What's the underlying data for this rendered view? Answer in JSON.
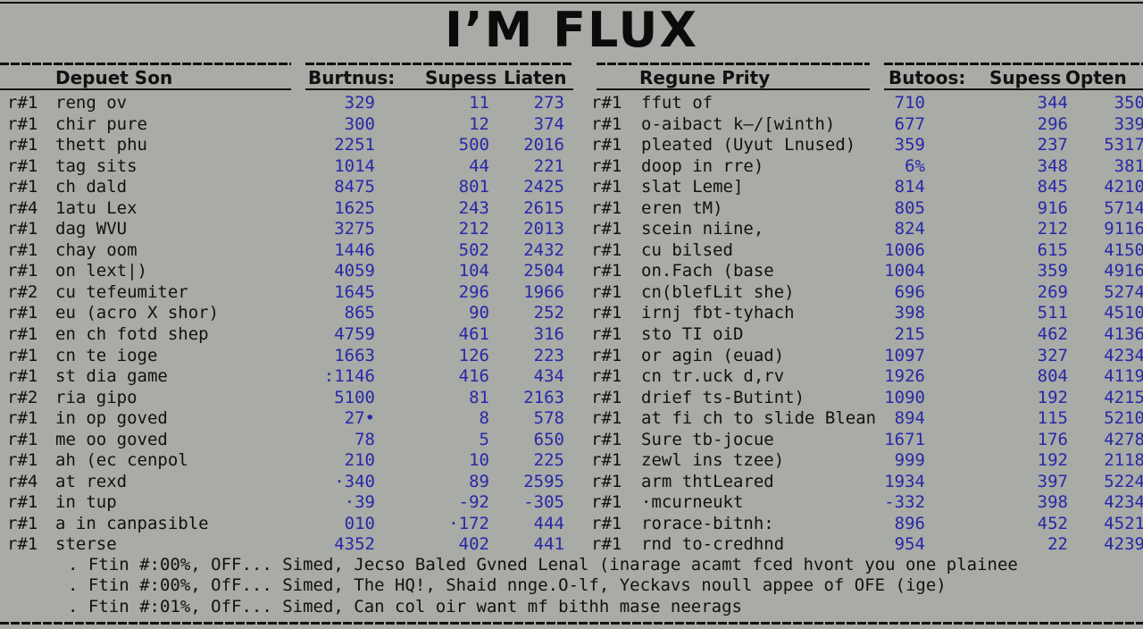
{
  "title": "I’M FLUX",
  "left_table": {
    "headers": [
      "Depuet Son",
      "Burtnus:",
      "Supess",
      "Liaten"
    ],
    "rows": [
      [
        "r#1",
        "reng ov",
        "329",
        "11",
        "273"
      ],
      [
        "r#1",
        "chir pure",
        "300",
        "12",
        "374"
      ],
      [
        "r#1",
        "thett phu",
        "2251",
        "500",
        "2016"
      ],
      [
        "r#1",
        "tag sits",
        "1014",
        "44",
        "221"
      ],
      [
        "r#1",
        "ch dald",
        "8475",
        "801",
        "2425"
      ],
      [
        "r#4",
        "1atu Lex",
        "1625",
        "243",
        "2615"
      ],
      [
        "r#1",
        "dag  WVU",
        "3275",
        "212",
        "2013"
      ],
      [
        "r#1",
        "chay oom",
        "1446",
        "502",
        "2432"
      ],
      [
        "r#1",
        "on lext|)",
        "4059",
        "104",
        "2504"
      ],
      [
        "r#2",
        "cu tefeumiter",
        "1645",
        "296",
        "1966"
      ],
      [
        "r#1",
        "eu (acro X shor)",
        "865",
        "90",
        "252"
      ],
      [
        "r#1",
        "en ch fotd shep",
        "4759",
        "461",
        "316"
      ],
      [
        "r#1",
        "cn te ioge",
        "1663",
        "126",
        "223"
      ],
      [
        "r#1",
        "st dia game",
        ":1146",
        "416",
        "434"
      ],
      [
        "r#2",
        "ria gipo",
        "5100",
        "81",
        "2163"
      ],
      [
        "r#1",
        "in op goved",
        "27•",
        "8",
        "578"
      ],
      [
        "r#1",
        "me oo goved",
        "78",
        "5",
        "650"
      ],
      [
        "r#1",
        "ah (ec cenpol",
        "210",
        "10",
        "225"
      ],
      [
        "r#4",
        "at rexd",
        "·340",
        "89",
        "2595"
      ],
      [
        "r#1",
        "in tup",
        "·39",
        "-92",
        "-305"
      ],
      [
        "r#1",
        "a in canpasible",
        "010",
        "·172",
        "444"
      ],
      [
        "r#1",
        "sterse",
        "4352",
        "402",
        "441"
      ]
    ]
  },
  "right_table": {
    "headers": [
      "Regune Prity",
      "Butoos:",
      "Supess",
      "Opten"
    ],
    "rows": [
      [
        "r#1",
        "ffut of",
        "710",
        "344",
        "350"
      ],
      [
        "r#1",
        "o-aibact k—/[winth)",
        "677",
        "296",
        "339"
      ],
      [
        "r#1",
        "pleated (Uyut Lnused)",
        "359",
        "237",
        "5317"
      ],
      [
        "r#1",
        "doop in rre)",
        "6%",
        "348",
        "381"
      ],
      [
        "r#1",
        "slat Leme]",
        "814",
        "845",
        "4210"
      ],
      [
        "r#1",
        "eren tM)",
        "805",
        "916",
        "5714"
      ],
      [
        "r#1",
        "scein niine,",
        "824",
        "212",
        "9116"
      ],
      [
        "r#1",
        "cu bilsed",
        "1006",
        "615",
        "4150"
      ],
      [
        "r#1",
        "on.Fach (base",
        "1004",
        "359",
        "4916"
      ],
      [
        "r#1",
        "cn(blefLit she)",
        "696",
        "269",
        "5274"
      ],
      [
        "r#1",
        "irnj fbt-tyhach",
        "398",
        "511",
        "4510"
      ],
      [
        "r#1",
        "sto TI oiD",
        "215",
        "462",
        "4136"
      ],
      [
        "r#1",
        "or agin (euad)",
        "1097",
        "327",
        "4234"
      ],
      [
        "r#1",
        "cn tr.uck d,rv",
        "1926",
        "804",
        "4119"
      ],
      [
        "r#1",
        "drief ts-Butint)",
        "1090",
        "192",
        "4215"
      ],
      [
        "r#1",
        "at fi ch to slide Blean",
        "894",
        "115",
        "5210"
      ],
      [
        "r#1",
        "Sure tb-jocue",
        "1671",
        "176",
        "4278"
      ],
      [
        "r#1",
        "zewl ins tzee)",
        "999",
        "192",
        "2118"
      ],
      [
        "r#1",
        "arm thtLeared",
        "1934",
        "397",
        "5224"
      ],
      [
        "r#1",
        "·mcurneukt",
        "-332",
        "398",
        "4234"
      ],
      [
        "r#1",
        "rorace-bitnh:",
        "896",
        "452",
        "4521"
      ],
      [
        "r#1",
        "rnd to-credhnd",
        "954",
        "22",
        "4239"
      ]
    ]
  },
  "notes": [
    ". Ftin #:00%, OFF... Simed, Jecso Baled Gvned Lenal (inarage acamt fced hvont you one plainee",
    ". Ftin #:00%, OfF... Simed, The HQ!, Shaid nnge.O-lf, Yeckavs noull appee of OFE (ige)",
    ". Ftin #:01%, OfF... Simed, Can col oir want mf bithh mase neerags"
  ]
}
